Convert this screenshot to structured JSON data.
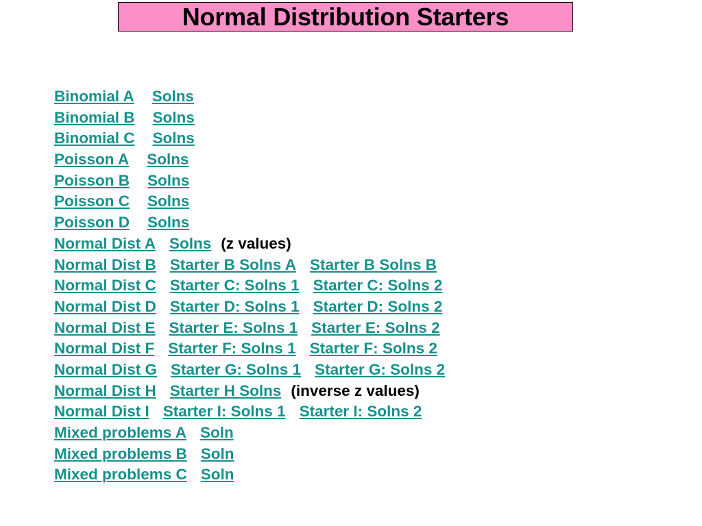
{
  "title": {
    "text": "Normal Distribution Starters",
    "background_color": "#fb8fc7",
    "border_color": "#000000",
    "text_color": "#000000"
  },
  "theme": {
    "link_color": "#17918c",
    "note_color": "#000000",
    "page_background": "#ffffff"
  },
  "rows": [
    {
      "primary": "Binomial A",
      "gap": "gap-lg",
      "links": [
        "Solns"
      ],
      "note": ""
    },
    {
      "primary": "Binomial B",
      "gap": "gap-lg",
      "links": [
        "Solns"
      ],
      "note": ""
    },
    {
      "primary": "Binomial C",
      "gap": "gap-lg",
      "links": [
        "Solns"
      ],
      "note": ""
    },
    {
      "primary": "Poisson A",
      "gap": "gap-lg",
      "links": [
        "Solns"
      ],
      "note": ""
    },
    {
      "primary": "Poisson B",
      "gap": "gap-lg",
      "links": [
        "Solns"
      ],
      "note": ""
    },
    {
      "primary": "Poisson C",
      "gap": "gap-lg",
      "links": [
        "Solns"
      ],
      "note": ""
    },
    {
      "primary": "Poisson D",
      "gap": "gap-lg",
      "links": [
        "Solns"
      ],
      "note": ""
    },
    {
      "primary": "Normal Dist A",
      "gap": "gap-md",
      "links": [
        "Solns"
      ],
      "note": "(z values)"
    },
    {
      "primary": "Normal Dist B",
      "gap": "gap-md",
      "links": [
        "Starter B Solns A",
        "Starter B Solns B"
      ],
      "note": ""
    },
    {
      "primary": "Normal Dist C",
      "gap": "gap-md",
      "links": [
        "Starter C: Solns 1",
        "Starter C: Solns 2"
      ],
      "note": ""
    },
    {
      "primary": "Normal Dist D",
      "gap": "gap-md",
      "links": [
        "Starter D: Solns 1",
        "Starter D: Solns 2"
      ],
      "note": ""
    },
    {
      "primary": "Normal Dist E",
      "gap": "gap-md",
      "links": [
        "Starter E: Solns 1",
        "Starter E: Solns 2"
      ],
      "note": ""
    },
    {
      "primary": "Normal Dist F",
      "gap": "gap-md",
      "links": [
        "Starter F: Solns 1",
        "Starter F: Solns 2"
      ],
      "note": ""
    },
    {
      "primary": "Normal Dist G",
      "gap": "gap-md",
      "links": [
        "Starter G: Solns 1",
        "Starter G: Solns 2"
      ],
      "note": ""
    },
    {
      "primary": "Normal Dist H",
      "gap": "gap-md",
      "links": [
        "Starter H Solns"
      ],
      "note": "(inverse z values)"
    },
    {
      "primary": "Normal Dist I",
      "gap": "gap-md",
      "links": [
        "Starter I: Solns 1",
        "Starter I: Solns 2"
      ],
      "note": ""
    },
    {
      "primary": "Mixed problems A",
      "gap": "gap-md",
      "links": [
        "Soln"
      ],
      "note": ""
    },
    {
      "primary": "Mixed problems B",
      "gap": "gap-md",
      "links": [
        "Soln"
      ],
      "note": ""
    },
    {
      "primary": "Mixed problems C",
      "gap": "gap-md",
      "links": [
        "Soln"
      ],
      "note": ""
    }
  ]
}
